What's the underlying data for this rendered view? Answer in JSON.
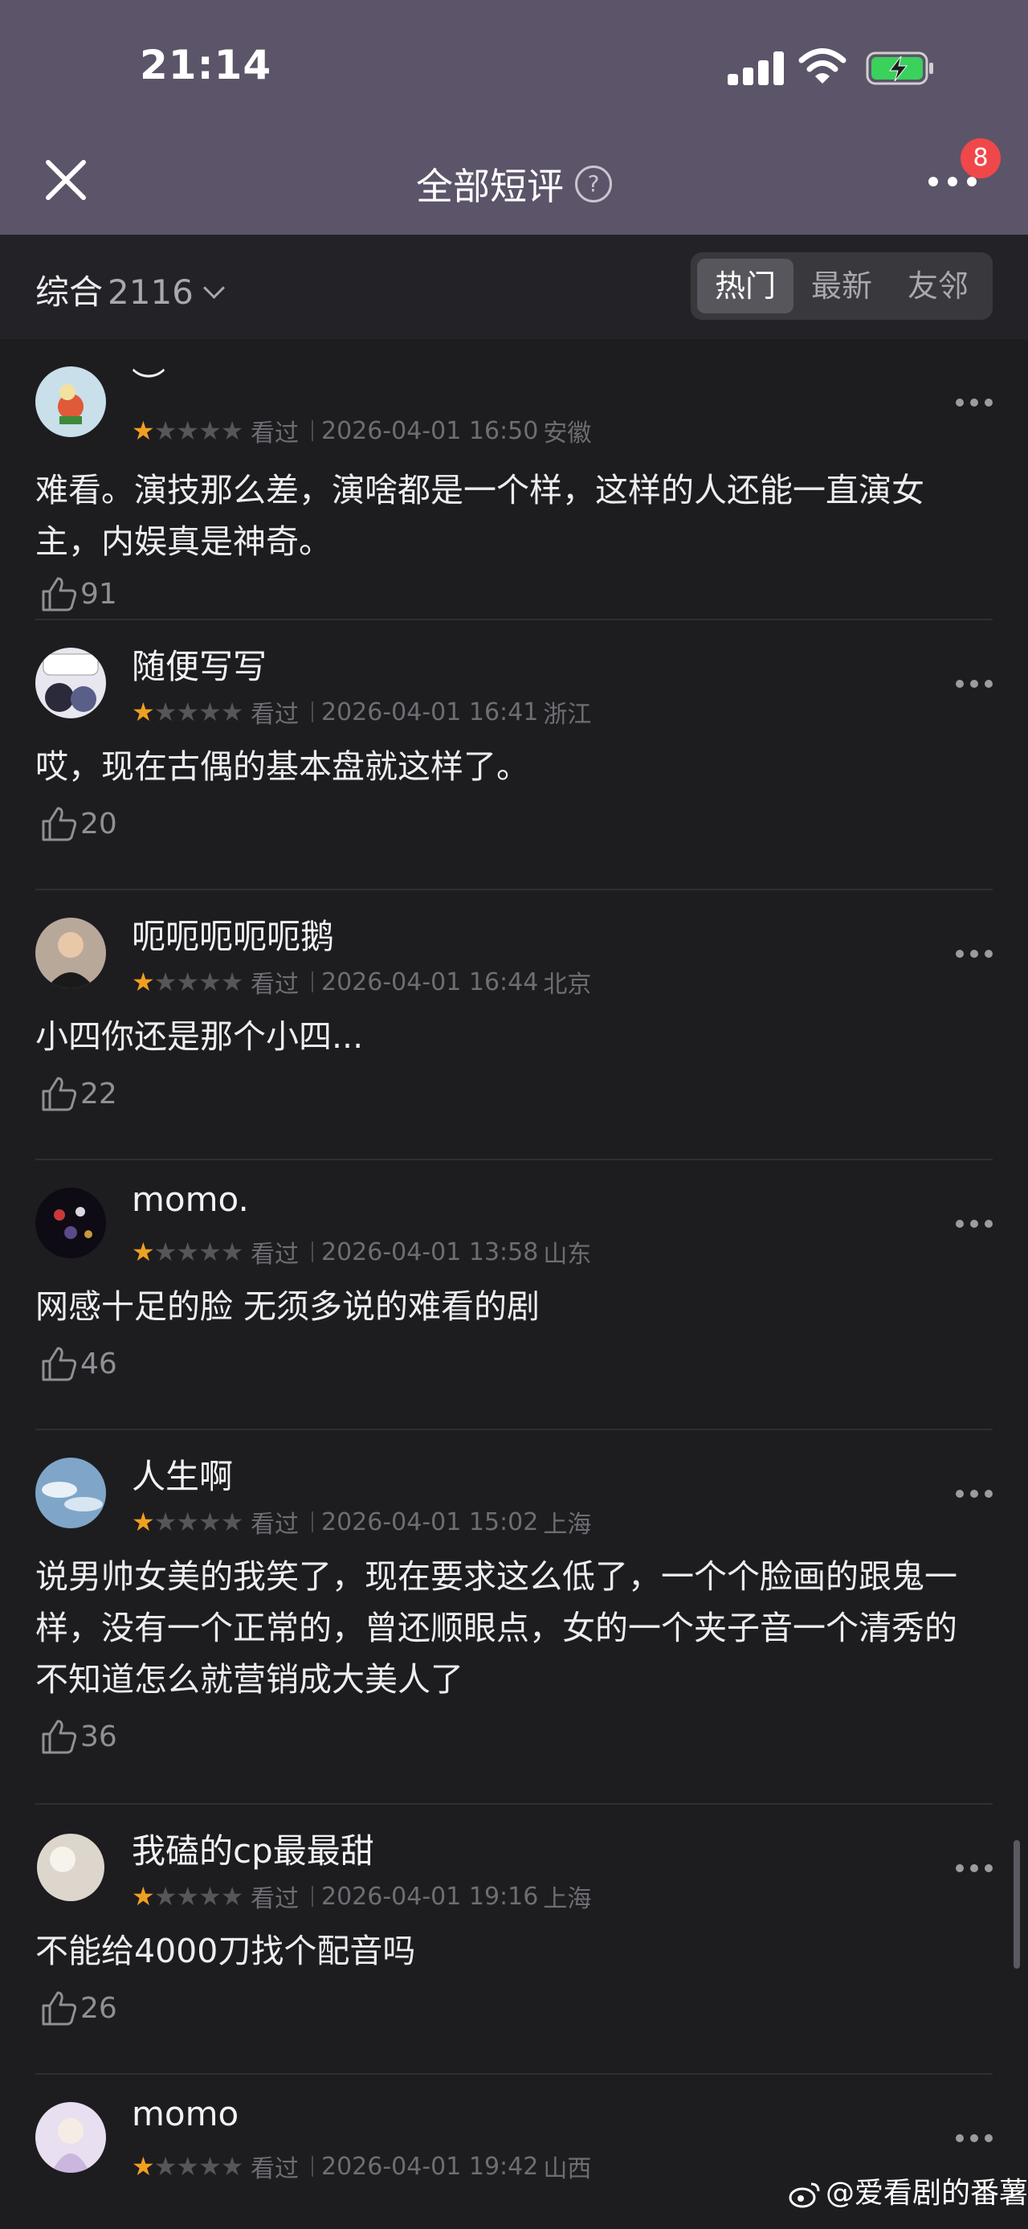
{
  "status": {
    "time": "21:14"
  },
  "nav": {
    "title": "全部短评",
    "badge": "8"
  },
  "filter": {
    "sort_label": "综合",
    "count": "2116",
    "tabs": [
      "热门",
      "最新",
      "友邻"
    ]
  },
  "reviews": [
    {
      "user": "︶",
      "stars": 1,
      "status": "看过",
      "time": "2026-04-01 16:50",
      "location": "安徽",
      "text": "难看。演技那么差，演啥都是一个样，这样的人还能一直演女主，内娱真是神奇。",
      "likes": "91"
    },
    {
      "user": "随便写写",
      "stars": 1,
      "status": "看过",
      "time": "2026-04-01 16:41",
      "location": "浙江",
      "text": "哎，现在古偶的基本盘就这样了。",
      "likes": "20"
    },
    {
      "user": "呃呃呃呃呃鹅",
      "stars": 1,
      "status": "看过",
      "time": "2026-04-01 16:44",
      "location": "北京",
      "text": "小四你还是那个小四...",
      "likes": "22"
    },
    {
      "user": "momo.",
      "stars": 1,
      "status": "看过",
      "time": "2026-04-01 13:58",
      "location": "山东",
      "text": "网感十足的脸 无须多说的难看的剧",
      "likes": "46"
    },
    {
      "user": "人生啊",
      "stars": 1,
      "status": "看过",
      "time": "2026-04-01 15:02",
      "location": "上海",
      "text": "说男帅女美的我笑了，现在要求这么低了，一个个脸画的跟鬼一样，没有一个正常的，曾还顺眼点，女的一个夹子音一个清秀的不知道怎么就营销成大美人了",
      "likes": "36"
    },
    {
      "user": "我磕的cp最最甜",
      "stars": 1,
      "status": "看过",
      "time": "2026-04-01 19:16",
      "location": "上海",
      "text": "不能给4000刀找个配音吗",
      "likes": "26"
    },
    {
      "user": "momo",
      "stars": 1,
      "status": "看过",
      "time": "2026-04-01 19:42",
      "location": "山西",
      "text": "",
      "likes": ""
    }
  ],
  "watermark": "@爱看剧的番薯",
  "colors": {
    "header": "#5c5468",
    "background": "#1d1d20",
    "star_on": "#f0a020",
    "badge": "#f0474a"
  },
  "icons": [
    "close-icon",
    "help-icon",
    "more-icon",
    "chevron-down-icon",
    "star-icon",
    "thumbs-up-icon",
    "weibo-icon"
  ]
}
